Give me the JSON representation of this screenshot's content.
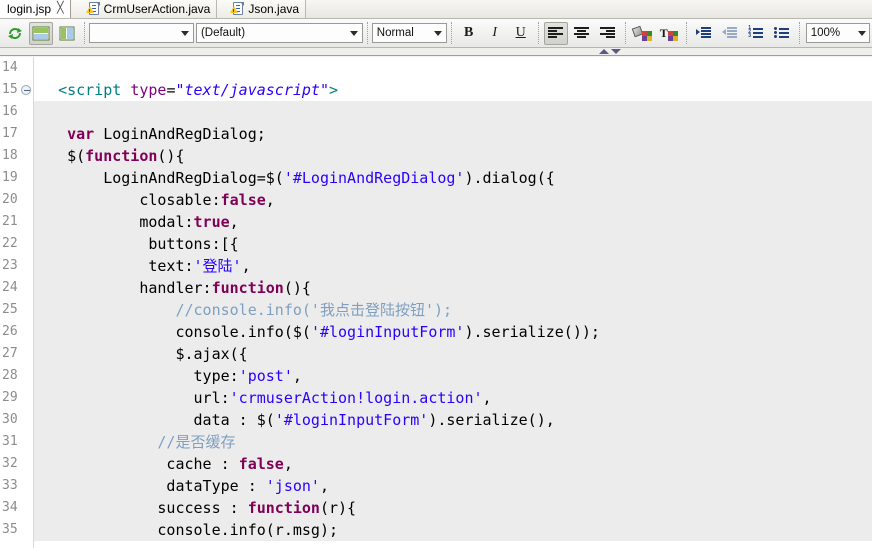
{
  "tabs": [
    {
      "label": "login.jsp",
      "active": true,
      "close_glyph": "╳",
      "icon": "none"
    },
    {
      "label": "CrmUserAction.java",
      "active": false,
      "icon": "java-warning-file-icon"
    },
    {
      "label": "Json.java",
      "active": false,
      "icon": "java-warning-file-icon"
    }
  ],
  "toolbar": {
    "refresh_icon": "refresh-icon",
    "layout_horizontal_icon": "layout-horizontal-split-icon",
    "layout_vertical_icon": "layout-vertical-split-icon",
    "font_combo": {
      "value": "",
      "placeholder": ""
    },
    "style_combo": {
      "value": "(Default)"
    },
    "paragraph_combo": {
      "value": "Normal"
    },
    "bold_label": "B",
    "italic_label": "I",
    "underline_label": "U",
    "align_left_icon": "align-left-icon",
    "align_center_icon": "align-center-icon",
    "align_right_icon": "align-right-icon",
    "fill_color_icon": "fill-color-icon",
    "text_color_icon": "text-color-icon",
    "indent_increase_icon": "indent-increase-icon",
    "indent_decrease_icon": "indent-decrease-icon",
    "ordered_list_icon": "ordered-list-icon",
    "unordered_list_icon": "unordered-list-icon",
    "zoom_combo": {
      "value": "100%"
    },
    "chevron_up_icon": "chevron-up-icon",
    "chevron_down_icon": "chevron-down-icon"
  },
  "editor": {
    "first_line_number": 14,
    "lines": [
      {
        "n": 14,
        "fold": false,
        "hl": false,
        "text": ""
      },
      {
        "n": 15,
        "fold": true,
        "hl": false,
        "text": "  <script type=\"text/javascript\">"
      },
      {
        "n": 16,
        "fold": false,
        "hl": true,
        "text": ""
      },
      {
        "n": 17,
        "fold": false,
        "hl": true,
        "text": "   var LoginAndRegDialog;"
      },
      {
        "n": 18,
        "fold": false,
        "hl": true,
        "text": "   $(function(){"
      },
      {
        "n": 19,
        "fold": false,
        "hl": true,
        "text": "       LoginAndRegDialog=$('#LoginAndRegDialog').dialog({"
      },
      {
        "n": 20,
        "fold": false,
        "hl": true,
        "text": "           closable:false,"
      },
      {
        "n": 21,
        "fold": false,
        "hl": true,
        "text": "           modal:true,"
      },
      {
        "n": 22,
        "fold": false,
        "hl": true,
        "text": "            buttons:[{"
      },
      {
        "n": 23,
        "fold": false,
        "hl": true,
        "text": "            text:'登陆',"
      },
      {
        "n": 24,
        "fold": false,
        "hl": true,
        "text": "           handler:function(){"
      },
      {
        "n": 25,
        "fold": false,
        "hl": true,
        "text": "               //console.info('我点击登陆按钮');"
      },
      {
        "n": 26,
        "fold": false,
        "hl": true,
        "text": "               console.info($('#loginInputForm').serialize());"
      },
      {
        "n": 27,
        "fold": false,
        "hl": true,
        "text": "               $.ajax({"
      },
      {
        "n": 28,
        "fold": false,
        "hl": true,
        "text": "                 type:'post',"
      },
      {
        "n": 29,
        "fold": false,
        "hl": true,
        "text": "                 url:'crmuserAction!login.action',"
      },
      {
        "n": 30,
        "fold": false,
        "hl": true,
        "text": "                 data : $('#loginInputForm').serialize(),"
      },
      {
        "n": 31,
        "fold": false,
        "hl": true,
        "text": "             //是否缓存"
      },
      {
        "n": 32,
        "fold": false,
        "hl": true,
        "text": "              cache : false,"
      },
      {
        "n": 33,
        "fold": false,
        "hl": true,
        "text": "              dataType : 'json',"
      },
      {
        "n": 34,
        "fold": false,
        "hl": true,
        "text": "             success : function(r){"
      },
      {
        "n": 35,
        "fold": false,
        "hl": true,
        "text": "             console.info(r.msg);"
      }
    ]
  },
  "colors": {
    "keyword": "#7f0055",
    "string": "#2a00ff",
    "comment": "#7f9fbf",
    "tag": "#008080",
    "attribute": "#7f007f",
    "highlight_background": "#ececec"
  }
}
